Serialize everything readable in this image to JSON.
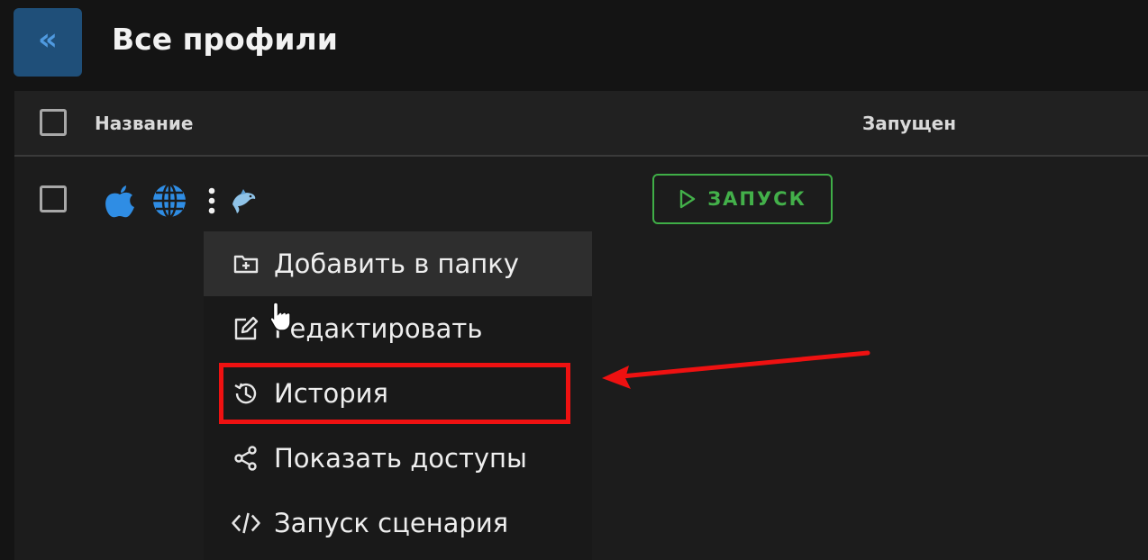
{
  "header": {
    "back_icon": "double-chevron-left-icon",
    "back_glyph": "«",
    "title": "Все профили"
  },
  "table": {
    "columns": [
      "Название",
      "Запущен"
    ],
    "rows": [
      {
        "icons": [
          "apple-icon",
          "globe-icon",
          "more-vertical-icon",
          "dolphin-icon"
        ],
        "run_label": "ЗАПУСК"
      }
    ]
  },
  "menu": {
    "items": [
      {
        "label": "Добавить в папку",
        "icon": "folder-add-icon"
      },
      {
        "label": "Редактировать",
        "icon": "edit-icon"
      },
      {
        "label": "История",
        "icon": "history-icon"
      },
      {
        "label": "Показать доступы",
        "icon": "share-icon"
      },
      {
        "label": "Запуск сценария",
        "icon": "code-icon"
      }
    ],
    "hovered_index": 0
  },
  "colors": {
    "accent_blue": "#1f4f79",
    "run_green": "#43b04a",
    "annotation_red": "#ee1111"
  }
}
